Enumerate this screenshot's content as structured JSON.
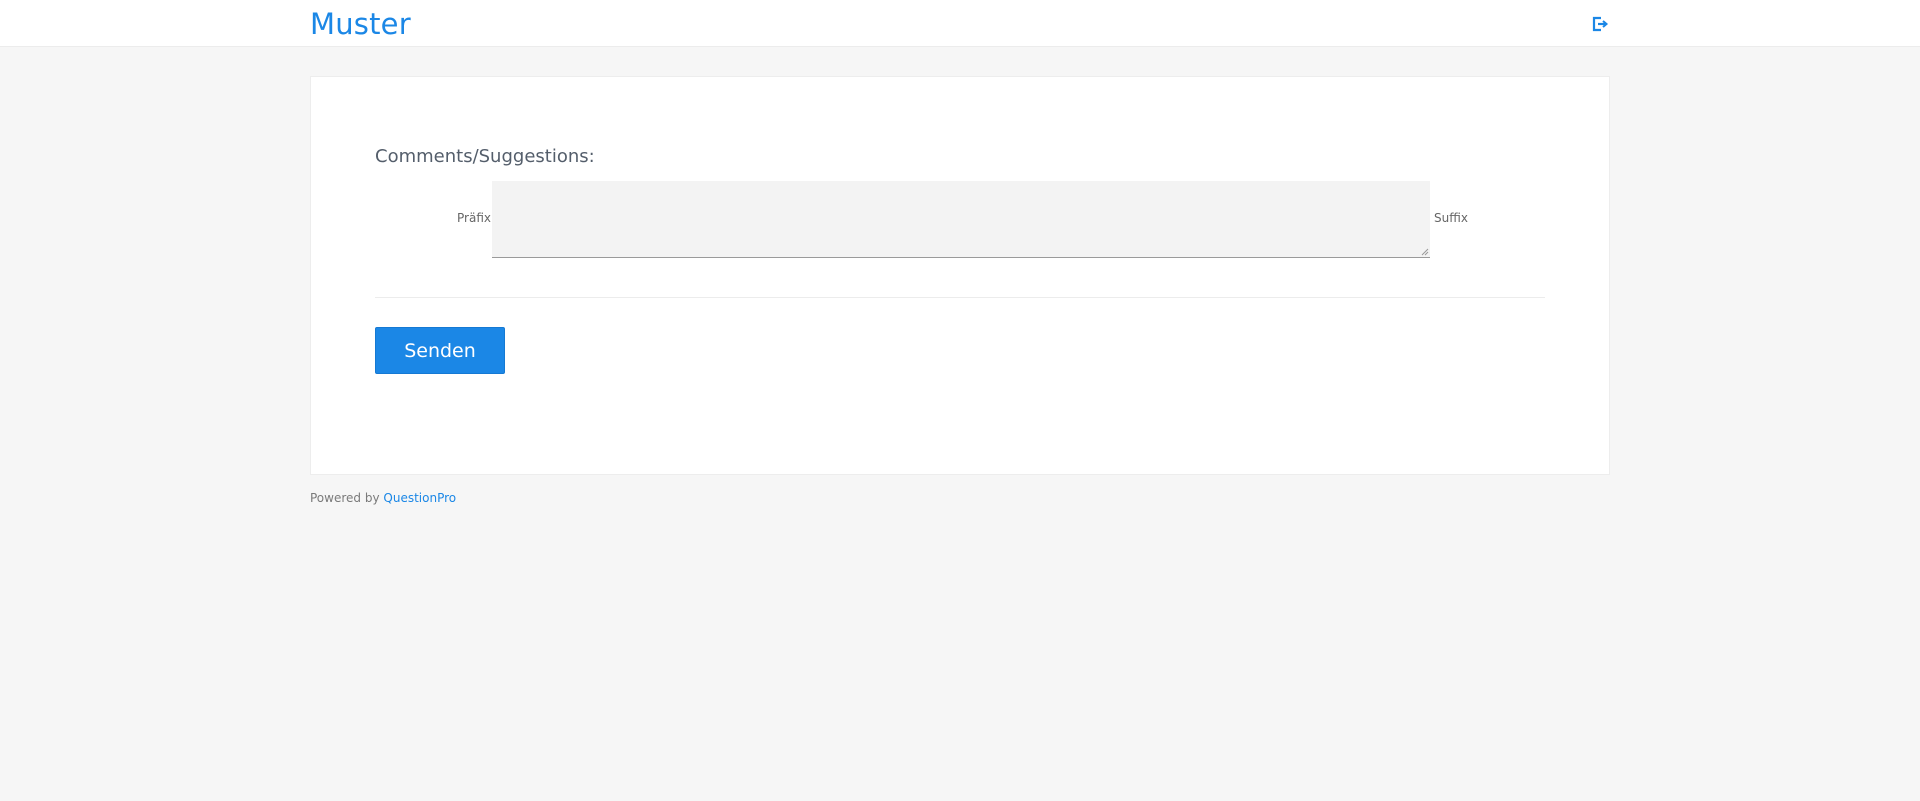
{
  "header": {
    "brand": "Muster",
    "exit_icon": "sign-out-icon"
  },
  "question": {
    "title": "Comments/Suggestions:",
    "prefix": "Präfix",
    "suffix": "Suffix",
    "answer_value": ""
  },
  "actions": {
    "submit_label": "Senden"
  },
  "footer": {
    "powered_by": "Powered by",
    "link_text": "QuestionPro"
  },
  "colors": {
    "accent": "#1b87e6",
    "background": "#f6f6f6",
    "card": "#ffffff"
  }
}
